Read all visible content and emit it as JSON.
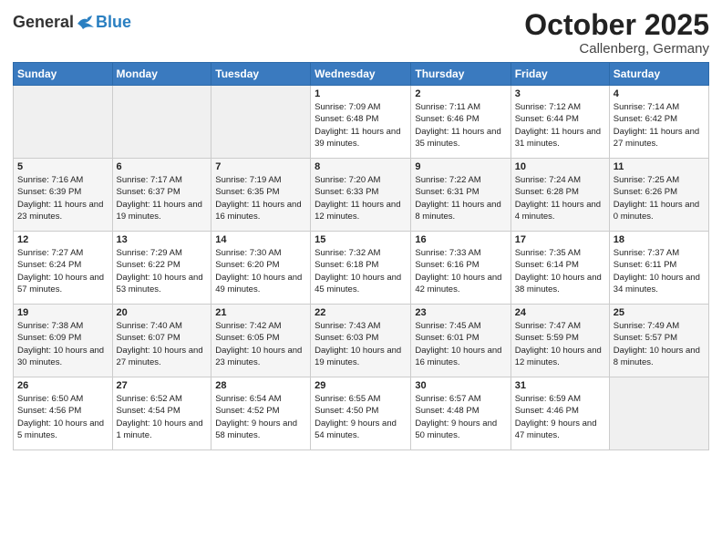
{
  "header": {
    "logo_general": "General",
    "logo_blue": "Blue",
    "month": "October 2025",
    "location": "Callenberg, Germany"
  },
  "weekdays": [
    "Sunday",
    "Monday",
    "Tuesday",
    "Wednesday",
    "Thursday",
    "Friday",
    "Saturday"
  ],
  "weeks": [
    [
      {
        "day": "",
        "info": ""
      },
      {
        "day": "",
        "info": ""
      },
      {
        "day": "",
        "info": ""
      },
      {
        "day": "1",
        "info": "Sunrise: 7:09 AM\nSunset: 6:48 PM\nDaylight: 11 hours\nand 39 minutes."
      },
      {
        "day": "2",
        "info": "Sunrise: 7:11 AM\nSunset: 6:46 PM\nDaylight: 11 hours\nand 35 minutes."
      },
      {
        "day": "3",
        "info": "Sunrise: 7:12 AM\nSunset: 6:44 PM\nDaylight: 11 hours\nand 31 minutes."
      },
      {
        "day": "4",
        "info": "Sunrise: 7:14 AM\nSunset: 6:42 PM\nDaylight: 11 hours\nand 27 minutes."
      }
    ],
    [
      {
        "day": "5",
        "info": "Sunrise: 7:16 AM\nSunset: 6:39 PM\nDaylight: 11 hours\nand 23 minutes."
      },
      {
        "day": "6",
        "info": "Sunrise: 7:17 AM\nSunset: 6:37 PM\nDaylight: 11 hours\nand 19 minutes."
      },
      {
        "day": "7",
        "info": "Sunrise: 7:19 AM\nSunset: 6:35 PM\nDaylight: 11 hours\nand 16 minutes."
      },
      {
        "day": "8",
        "info": "Sunrise: 7:20 AM\nSunset: 6:33 PM\nDaylight: 11 hours\nand 12 minutes."
      },
      {
        "day": "9",
        "info": "Sunrise: 7:22 AM\nSunset: 6:31 PM\nDaylight: 11 hours\nand 8 minutes."
      },
      {
        "day": "10",
        "info": "Sunrise: 7:24 AM\nSunset: 6:28 PM\nDaylight: 11 hours\nand 4 minutes."
      },
      {
        "day": "11",
        "info": "Sunrise: 7:25 AM\nSunset: 6:26 PM\nDaylight: 11 hours\nand 0 minutes."
      }
    ],
    [
      {
        "day": "12",
        "info": "Sunrise: 7:27 AM\nSunset: 6:24 PM\nDaylight: 10 hours\nand 57 minutes."
      },
      {
        "day": "13",
        "info": "Sunrise: 7:29 AM\nSunset: 6:22 PM\nDaylight: 10 hours\nand 53 minutes."
      },
      {
        "day": "14",
        "info": "Sunrise: 7:30 AM\nSunset: 6:20 PM\nDaylight: 10 hours\nand 49 minutes."
      },
      {
        "day": "15",
        "info": "Sunrise: 7:32 AM\nSunset: 6:18 PM\nDaylight: 10 hours\nand 45 minutes."
      },
      {
        "day": "16",
        "info": "Sunrise: 7:33 AM\nSunset: 6:16 PM\nDaylight: 10 hours\nand 42 minutes."
      },
      {
        "day": "17",
        "info": "Sunrise: 7:35 AM\nSunset: 6:14 PM\nDaylight: 10 hours\nand 38 minutes."
      },
      {
        "day": "18",
        "info": "Sunrise: 7:37 AM\nSunset: 6:11 PM\nDaylight: 10 hours\nand 34 minutes."
      }
    ],
    [
      {
        "day": "19",
        "info": "Sunrise: 7:38 AM\nSunset: 6:09 PM\nDaylight: 10 hours\nand 30 minutes."
      },
      {
        "day": "20",
        "info": "Sunrise: 7:40 AM\nSunset: 6:07 PM\nDaylight: 10 hours\nand 27 minutes."
      },
      {
        "day": "21",
        "info": "Sunrise: 7:42 AM\nSunset: 6:05 PM\nDaylight: 10 hours\nand 23 minutes."
      },
      {
        "day": "22",
        "info": "Sunrise: 7:43 AM\nSunset: 6:03 PM\nDaylight: 10 hours\nand 19 minutes."
      },
      {
        "day": "23",
        "info": "Sunrise: 7:45 AM\nSunset: 6:01 PM\nDaylight: 10 hours\nand 16 minutes."
      },
      {
        "day": "24",
        "info": "Sunrise: 7:47 AM\nSunset: 5:59 PM\nDaylight: 10 hours\nand 12 minutes."
      },
      {
        "day": "25",
        "info": "Sunrise: 7:49 AM\nSunset: 5:57 PM\nDaylight: 10 hours\nand 8 minutes."
      }
    ],
    [
      {
        "day": "26",
        "info": "Sunrise: 6:50 AM\nSunset: 4:56 PM\nDaylight: 10 hours\nand 5 minutes."
      },
      {
        "day": "27",
        "info": "Sunrise: 6:52 AM\nSunset: 4:54 PM\nDaylight: 10 hours\nand 1 minute."
      },
      {
        "day": "28",
        "info": "Sunrise: 6:54 AM\nSunset: 4:52 PM\nDaylight: 9 hours\nand 58 minutes."
      },
      {
        "day": "29",
        "info": "Sunrise: 6:55 AM\nSunset: 4:50 PM\nDaylight: 9 hours\nand 54 minutes."
      },
      {
        "day": "30",
        "info": "Sunrise: 6:57 AM\nSunset: 4:48 PM\nDaylight: 9 hours\nand 50 minutes."
      },
      {
        "day": "31",
        "info": "Sunrise: 6:59 AM\nSunset: 4:46 PM\nDaylight: 9 hours\nand 47 minutes."
      },
      {
        "day": "",
        "info": ""
      }
    ]
  ]
}
